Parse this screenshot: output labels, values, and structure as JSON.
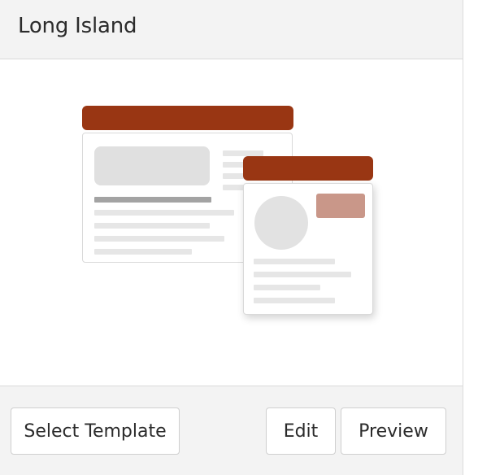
{
  "card": {
    "title": "Long Island"
  },
  "footer": {
    "select_template_label": "Select Template",
    "edit_label": "Edit",
    "preview_label": "Preview"
  },
  "illustration": {
    "icon": "template-layout-illustration",
    "accent_color": "#993613",
    "badge_color": "#c99789"
  }
}
